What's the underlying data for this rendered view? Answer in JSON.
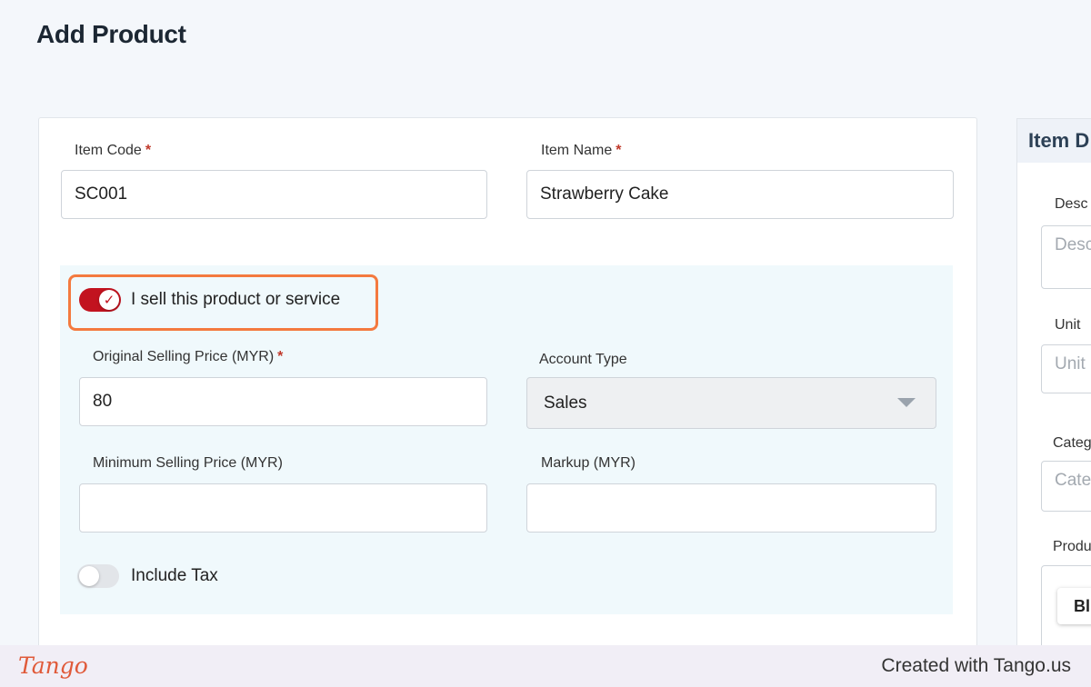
{
  "page": {
    "title": "Add Product"
  },
  "form": {
    "item_code": {
      "label": "Item Code",
      "required_mark": "*",
      "value": "SC001"
    },
    "item_name": {
      "label": "Item Name",
      "required_mark": "*",
      "value": "Strawberry Cake"
    },
    "sell_toggle": {
      "label": "I sell this product or service",
      "checked": true
    },
    "original_price": {
      "label": "Original Selling Price (MYR)",
      "required_mark": "*",
      "value": "80"
    },
    "account_type": {
      "label": "Account Type",
      "value": "Sales"
    },
    "minimum_price": {
      "label": "Minimum Selling Price (MYR)",
      "value": ""
    },
    "markup": {
      "label": "Markup (MYR)",
      "value": ""
    },
    "include_tax": {
      "label": "Include Tax",
      "checked": false
    }
  },
  "side_panel": {
    "title": "Item D",
    "description_label": "Desc",
    "description_placeholder": "Desc",
    "unit_label": "Unit",
    "unit_placeholder": "Unit",
    "category_label": "Categ",
    "category_placeholder": "Cate",
    "product_label": "Produ",
    "button_label": "Bl"
  },
  "footer": {
    "logo": "Tango",
    "credit": "Created with Tango.us"
  },
  "colors": {
    "toggle_on": "#c2131f",
    "highlight": "#f47a3f",
    "section_bg": "#f0f9fc"
  }
}
